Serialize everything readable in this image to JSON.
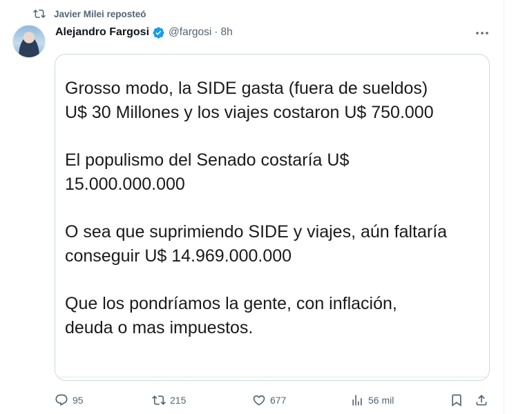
{
  "repost": {
    "text": "Javier Milei reposteó",
    "icon": "repost-icon"
  },
  "author": {
    "name": "Alejandro Fargosi",
    "handle": "@fargosi",
    "separator": "·",
    "time": "8h",
    "verified_color": "#1d9bf0"
  },
  "post": {
    "paragraphs": [
      "Grosso modo, la SIDE gasta (fuera de sueldos)\nU$ 30 Millones y los viajes costaron U$ 750.000",
      "El populismo del Senado costaría U$\n15.000.000.000",
      "O sea que suprimiendo SIDE y viajes, aún faltaría\nconseguir U$ 14.969.000.000",
      "Que los pondríamos la gente, con inflación,\ndeuda o mas impuestos."
    ]
  },
  "actions": {
    "replies": "95",
    "reposts": "215",
    "likes": "677",
    "views": "56 mil"
  },
  "colors": {
    "muted": "#536471",
    "border": "#cfd9de",
    "text": "#0f1419",
    "accent": "#1d9bf0"
  }
}
